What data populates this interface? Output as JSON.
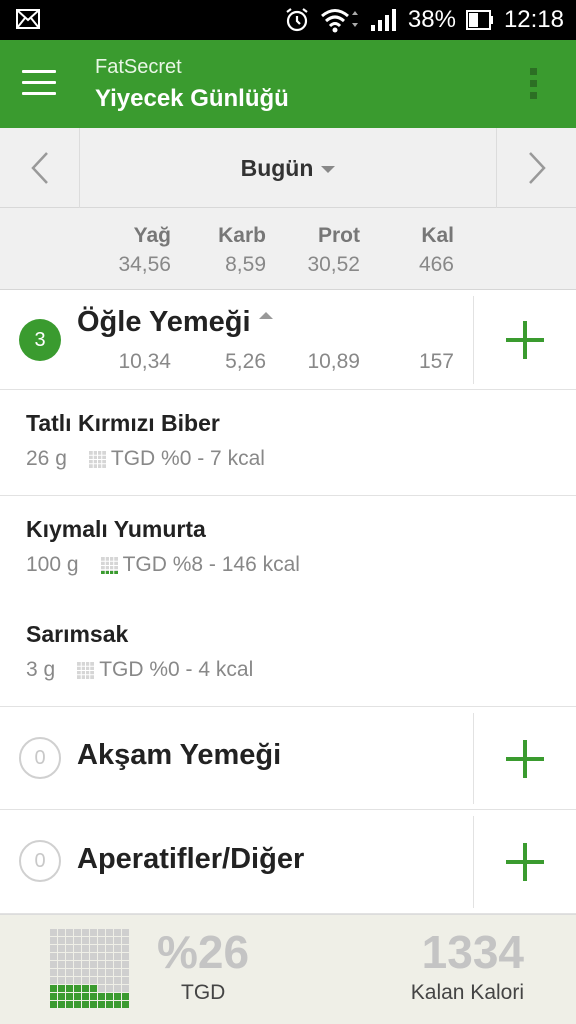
{
  "status_bar": {
    "battery": "38%",
    "time": "12:18"
  },
  "app_bar": {
    "app_name": "FatSecret",
    "title": "Yiyecek Günlüğü"
  },
  "date_nav": {
    "label": "Bugün"
  },
  "totals": {
    "headers": [
      "Yağ",
      "Karb",
      "Prot",
      "Kal"
    ],
    "values": [
      "34,56",
      "8,59",
      "30,52",
      "466"
    ]
  },
  "meals": [
    {
      "count": "3",
      "title": "Öğle Yemeği",
      "values": [
        "10,34",
        "5,26",
        "10,89",
        "157"
      ]
    },
    {
      "count": "0",
      "title": "Akşam Yemeği"
    },
    {
      "count": "0",
      "title": "Aperatifler/Diğer"
    }
  ],
  "foods": [
    {
      "name": "Tatlı Kırmızı Biber",
      "qty": "26  g",
      "info": "TGD %0 - 7 kcal"
    },
    {
      "name": "Kıymalı Yumurta",
      "qty": "100  g",
      "info": "TGD %8 - 146 kcal"
    },
    {
      "name": "Sarımsak",
      "qty": "3  g",
      "info": "TGD %0 - 4 kcal"
    }
  ],
  "summary": {
    "percent": "%26",
    "percent_label": "TGD",
    "calories": "1334",
    "calories_label": "Kalan Kalori",
    "rdi_fraction": 0.26
  },
  "colors": {
    "brand_green": "#3a9b2f",
    "muted_text": "#888888"
  },
  "icons": [
    "mail-icon",
    "alarm-icon",
    "wifi-icon",
    "signal-icon",
    "battery-icon",
    "menu-icon",
    "overflow-icon",
    "chevron-left-icon",
    "chevron-right-icon",
    "plus-icon",
    "rdi-meter-icon"
  ]
}
